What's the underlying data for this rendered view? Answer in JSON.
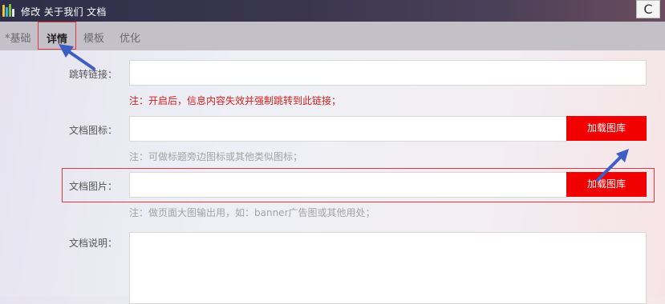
{
  "window": {
    "title": "修改 关于我们 文档",
    "refresh_glyph": "C"
  },
  "tabs": [
    {
      "label": "*基础",
      "active": false
    },
    {
      "label": "详情",
      "active": true
    },
    {
      "label": "模板",
      "active": false
    },
    {
      "label": "优化",
      "active": false
    }
  ],
  "form": {
    "redirect_link": {
      "label": "跳转链接：",
      "value": "",
      "hint": "注：开启后，信息内容失效并强制跳转到此链接；"
    },
    "doc_icon": {
      "label": "文档图标：",
      "value": "",
      "button": "加载图库",
      "hint": "注：可做标题旁边图标或其他类似图标；"
    },
    "doc_image": {
      "label": "文档图片：",
      "value": "",
      "button": "加载图库",
      "hint": "注：做页面大图输出用，如：banner广告图或其他用处；"
    },
    "doc_description": {
      "label": "文档说明：",
      "value": ""
    }
  },
  "colors": {
    "accent_red": "#f00000",
    "highlight_border": "#e0383b",
    "annotation_arrow": "#3d5fc4"
  }
}
